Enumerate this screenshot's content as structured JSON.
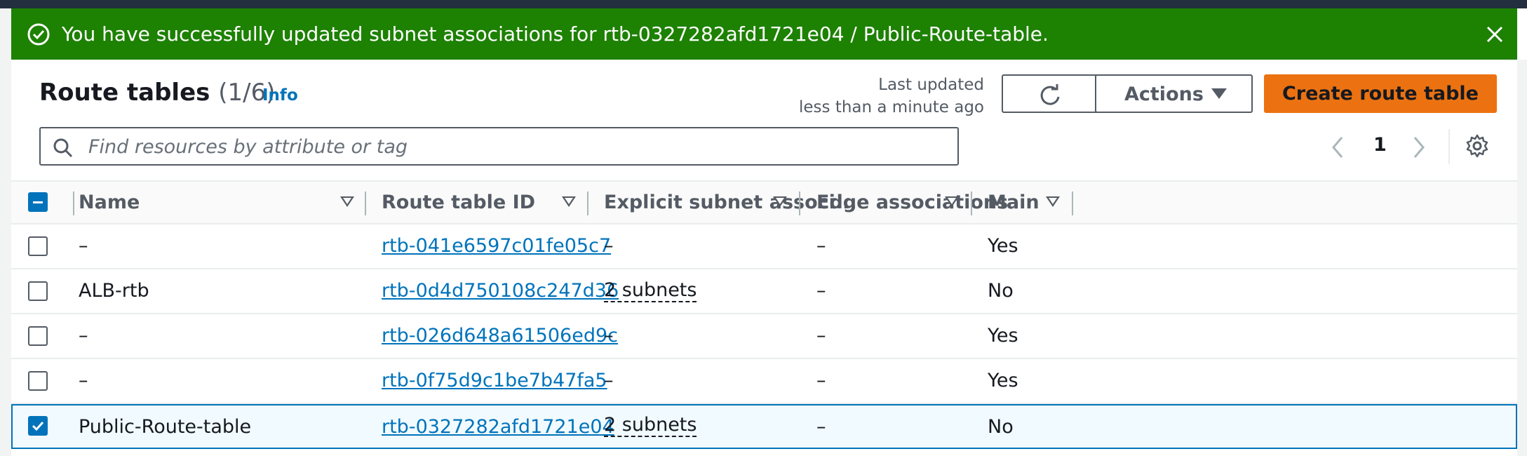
{
  "flash": {
    "message": "You have successfully updated subnet associations for rtb-0327282afd1721e04 / Public-Route-table.",
    "color": "#1d8102"
  },
  "header": {
    "title": "Route tables",
    "count": "(1/6)",
    "info": "Info",
    "last_updated_line1": "Last updated",
    "last_updated_line2": "less than a minute ago",
    "actions_label": "Actions",
    "create_label": "Create route table"
  },
  "search": {
    "placeholder": "Find resources by attribute or tag"
  },
  "pagination": {
    "page": "1"
  },
  "table": {
    "columns": [
      "Name",
      "Route table ID",
      "Explicit subnet associ...",
      "Edge associations",
      "Main"
    ],
    "rows": [
      {
        "name": "–",
        "id": "rtb-041e6597c01fe05c7",
        "explicit": "–",
        "edge": "–",
        "main": "Yes",
        "selected": false
      },
      {
        "name": "ALB-rtb",
        "id": "rtb-0d4d750108c247d36",
        "explicit": "2 subnets",
        "edge": "–",
        "main": "No",
        "selected": false
      },
      {
        "name": "–",
        "id": "rtb-026d648a61506ed9c",
        "explicit": "–",
        "edge": "–",
        "main": "Yes",
        "selected": false
      },
      {
        "name": "–",
        "id": "rtb-0f75d9c1be7b47fa5",
        "explicit": "–",
        "edge": "–",
        "main": "Yes",
        "selected": false
      },
      {
        "name": "Public-Route-table",
        "id": "rtb-0327282afd1721e04",
        "explicit": "2 subnets",
        "edge": "–",
        "main": "No",
        "selected": true
      }
    ]
  },
  "colors": {
    "accent": "#ec7211",
    "link": "#0073bb",
    "success": "#1d8102"
  },
  "icons": {
    "flash": "success-circle-icon",
    "close": "close-icon",
    "refresh": "refresh-icon",
    "search": "search-icon",
    "settings": "gear-icon"
  }
}
